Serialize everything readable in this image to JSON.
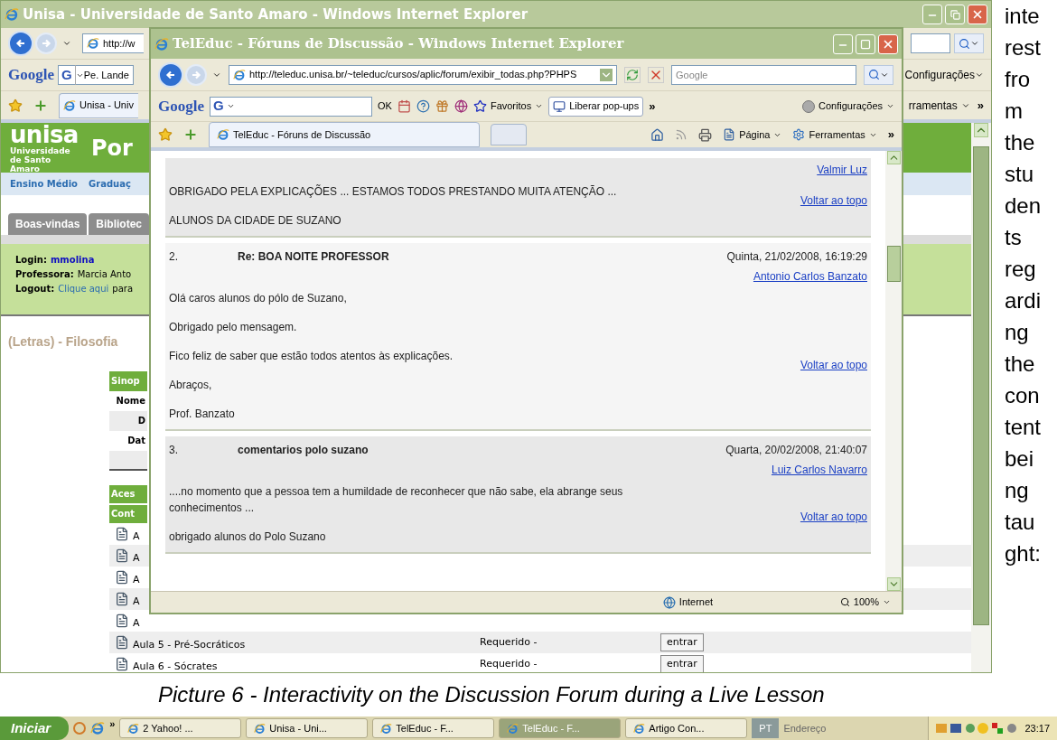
{
  "back_window": {
    "title": "Unisa - Universidade de Santo Amaro - Windows Internet Explorer",
    "address": "http://w",
    "google": {
      "logo": "Google",
      "g_button": "G",
      "search_text": "Pe. Lande",
      "settings": "Configurações"
    },
    "tab": "Unisa - Univ",
    "tools": "rramentas",
    "overflow": "»",
    "page": {
      "logo": {
        "name": "unisa",
        "subtitle": "Universidade de Santo Amaro"
      },
      "header_title": "Por",
      "nav": [
        "Ensino Médio",
        "Graduaç"
      ],
      "tabs": [
        {
          "label": "Boas-vindas",
          "selected": false
        },
        {
          "label": "Bibliotec",
          "selected": false
        }
      ],
      "login": [
        {
          "label": "Login:",
          "value": "mmolina",
          "kind": "user"
        },
        {
          "label": "Professora:",
          "value": "Marcia Anto",
          "kind": "text"
        },
        {
          "label": "Logout:",
          "value": "Clique aqui",
          "suffix": "para",
          "kind": "link"
        }
      ],
      "course_title": "(Letras) - Filosofia",
      "synopsis": {
        "header": "Sinop",
        "rows": [
          "Nome",
          "D",
          "Dat"
        ]
      },
      "access_header": "Aces",
      "content_header": "Cont",
      "lessons": [
        {
          "name": "A"
        },
        {
          "name": "A"
        },
        {
          "name": "A"
        },
        {
          "name": "A"
        },
        {
          "name": "A"
        },
        {
          "name": "Aula 5 - Pré-Socráticos",
          "status": "Requerido -",
          "action": "entrar"
        },
        {
          "name": "Aula 6 - Sócrates",
          "status": "Requerido -",
          "action": "entrar"
        }
      ]
    }
  },
  "front_window": {
    "title": "TelEduc - Fóruns de Discussão - Windows Internet Explorer",
    "address": "http://teleduc.unisa.br/~teleduc/cursos/aplic/forum/exibir_todas.php?PHPS",
    "search_placeholder": "Google",
    "google": {
      "logo": "Google",
      "g_button": "G",
      "ok": "OK",
      "favorites": "Favoritos",
      "popups": "Liberar pop-ups",
      "overflow": "»",
      "settings": "Configurações"
    },
    "tab": "TelEduc - Fóruns de Discussão",
    "page_menu": "Página",
    "tools_menu": "Ferramentas",
    "overflow": "»",
    "posts": [
      {
        "author": "Valmir Luz",
        "paragraphs": [
          {
            "text": "OBRIGADO PELA EXPLICAÇÕES ... ESTAMOS TODOS PRESTANDO MUITA ATENÇÃO ...",
            "link": "Voltar ao topo"
          },
          {
            "text": "ALUNOS DA CIDADE DE SUZANO"
          }
        ]
      },
      {
        "number": "2.",
        "title": "Re: BOA NOITE PROFESSOR",
        "date": "Quinta, 21/02/2008, 16:19:29",
        "author": "Antonio Carlos Banzato",
        "paragraphs": [
          {
            "text": "Olá caros alunos do pólo de Suzano,"
          },
          {
            "text": "Obrigado pelo mensagem."
          },
          {
            "text": "Fico feliz de saber que estão todos atentos às explicações.",
            "link": "Voltar ao topo"
          },
          {
            "text": "Abraços,"
          },
          {
            "text": "Prof. Banzato"
          }
        ]
      },
      {
        "number": "3.",
        "title": "comentarios polo suzano",
        "date": "Quarta, 20/02/2008, 21:40:07",
        "author": "Luiz Carlos Navarro",
        "paragraphs": [
          {
            "text": "....no momento que a pessoa tem a humildade de reconhecer que não sabe, ela abrange seus conhecimentos ...",
            "link": "Voltar ao topo"
          },
          {
            "text": "obrigado alunos do Polo Suzano"
          }
        ]
      }
    ],
    "status_bar": {
      "zone": "Internet",
      "zoom": "100%"
    }
  },
  "caption": "Picture 6 - Interactivity on the Discussion Forum during a Live Lesson",
  "side_text": "interest from the students regarding the content being taught:",
  "taskbar": {
    "start": "Iniciar",
    "overflow": "»",
    "buttons": [
      {
        "label": "2 Yahoo! ...",
        "selected": false
      },
      {
        "label": "Unisa - Uni...",
        "selected": false
      },
      {
        "label": "TelEduc - F...",
        "selected": false
      },
      {
        "label": "TelEduc - F...",
        "selected": true
      },
      {
        "label": "Artigo Con...",
        "selected": false
      }
    ],
    "language": "PT",
    "address": "Endereço",
    "clock": "23:17"
  }
}
